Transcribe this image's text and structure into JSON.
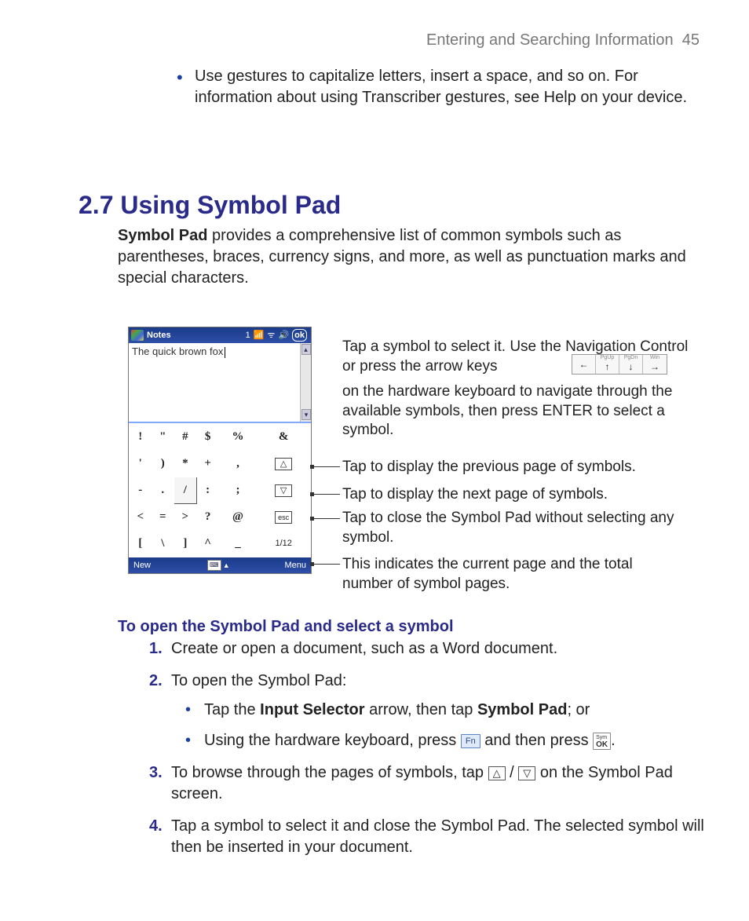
{
  "header": {
    "title": "Entering and Searching Information",
    "page": "45"
  },
  "top_bullet": "Use gestures to capitalize letters, insert a space, and so on. For information about using Transcriber gestures, see Help on your device.",
  "section": {
    "number": "2.7",
    "title": "Using Symbol Pad"
  },
  "intro": {
    "lead_bold": "Symbol Pad",
    "rest": " provides a comprehensive list of common symbols such as parentheses, braces, currency signs, and more, as well as punctuation marks and special characters."
  },
  "screenshot": {
    "title": "Notes",
    "title_count": "1",
    "ok": "ok",
    "doc_text": "The quick brown fox",
    "rows": [
      [
        "!",
        "\"",
        "#",
        "$",
        "%",
        "&"
      ],
      [
        "'",
        ")",
        "*",
        "+",
        ",",
        "△"
      ],
      [
        "-",
        ".",
        "/",
        ":",
        ";",
        "▽"
      ],
      [
        "<",
        "=",
        ">",
        "?",
        "@",
        "esc"
      ],
      [
        "[",
        "\\",
        "]",
        "^",
        "_",
        "1/12"
      ]
    ],
    "bottom_left": "New",
    "bottom_right": "Menu"
  },
  "arrow_keys": [
    {
      "lbl": "",
      "g": "←"
    },
    {
      "lbl": "PgUp",
      "g": "↑"
    },
    {
      "lbl": "PgDn",
      "g": "↓"
    },
    {
      "lbl": "Win",
      "g": "→"
    }
  ],
  "callouts": {
    "c1a": "Tap a symbol to select it. Use the Navigation Control or press the arrow keys",
    "c1b": "on the hardware keyboard to navigate through the available symbols, then press ENTER to select a symbol.",
    "c2": "Tap to display the previous page of symbols.",
    "c3": "Tap to display the next page of symbols.",
    "c4": "Tap to close the Symbol Pad without selecting any symbol.",
    "c5": "This indicates the current page and the total number of symbol pages."
  },
  "subhead": "To open the Symbol Pad and select a symbol",
  "steps": {
    "s1": "Create or open a document, such as a Word document.",
    "s2": "To open the Symbol Pad:",
    "s2a_pre": "Tap the ",
    "s2a_b1": "Input Selector",
    "s2a_mid": " arrow, then tap ",
    "s2a_b2": "Symbol Pad",
    "s2a_post": "; or",
    "s2b_pre": "Using the hardware keyboard, press ",
    "s2b_key1": "Fn",
    "s2b_mid": " and then press ",
    "s2b_key2_top": "Sym",
    "s2b_key2": "OK",
    "s2b_post": ".",
    "s3_pre": "To browse through the pages of symbols, tap ",
    "s3_mid": " / ",
    "s3_post": " on the Symbol Pad screen.",
    "s4": "Tap a symbol to select it and close the Symbol Pad. The selected symbol will then be inserted in your document."
  }
}
